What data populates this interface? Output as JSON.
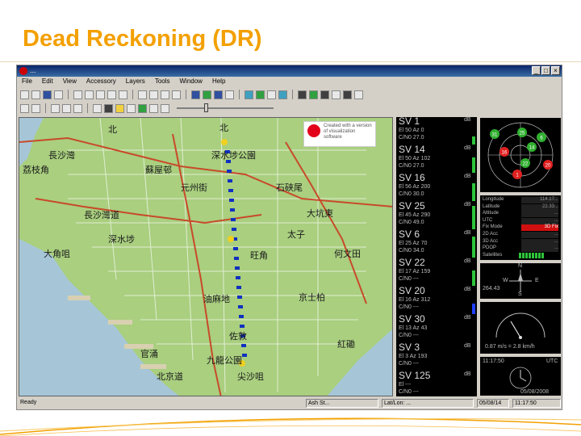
{
  "slide": {
    "title": "Dead Reckoning (DR)"
  },
  "window": {
    "title": "...",
    "menu": [
      "File",
      "Edit",
      "View",
      "Accessory",
      "Layers",
      "Tools",
      "Window",
      "Help"
    ]
  },
  "map": {
    "watermark": "Created with a version of\nvisualization software",
    "labels": [
      {
        "text": "北",
        "l": 110,
        "t": 6
      },
      {
        "text": "北",
        "l": 248,
        "t": 4
      },
      {
        "text": "深水埗公園",
        "l": 238,
        "t": 38
      },
      {
        "text": "長沙灣",
        "l": 36,
        "t": 38
      },
      {
        "text": "蘇屋邨",
        "l": 156,
        "t": 56
      },
      {
        "text": "荔枝角",
        "l": 4,
        "t": 56
      },
      {
        "text": "元州街",
        "l": 200,
        "t": 78
      },
      {
        "text": "石硤尾",
        "l": 318,
        "t": 78
      },
      {
        "text": "大坑東",
        "l": 356,
        "t": 110
      },
      {
        "text": "長沙灣道",
        "l": 80,
        "t": 112
      },
      {
        "text": "深水埗",
        "l": 110,
        "t": 142
      },
      {
        "text": "太子",
        "l": 332,
        "t": 136
      },
      {
        "text": "大角咀",
        "l": 30,
        "t": 160
      },
      {
        "text": "旺角",
        "l": 286,
        "t": 162
      },
      {
        "text": "何文田",
        "l": 390,
        "t": 160
      },
      {
        "text": "油麻地",
        "l": 228,
        "t": 216
      },
      {
        "text": "京士柏",
        "l": 346,
        "t": 214
      },
      {
        "text": "佐敦",
        "l": 260,
        "t": 262
      },
      {
        "text": "官涌",
        "l": 150,
        "t": 284
      },
      {
        "text": "紅磡",
        "l": 394,
        "t": 272
      },
      {
        "text": "尖沙咀",
        "l": 270,
        "t": 312
      },
      {
        "text": "北京道",
        "l": 170,
        "t": 312
      },
      {
        "text": "九龍公園",
        "l": 232,
        "t": 292
      }
    ]
  },
  "satellites": [
    {
      "name": "SV 1",
      "el": "El 50 Az 0",
      "cn": "C/N0 27.0",
      "bar": 30,
      "blue": false
    },
    {
      "name": "SV 14",
      "el": "El 50 Az 102",
      "cn": "C/N0 27.0",
      "bar": 60,
      "blue": false
    },
    {
      "name": "SV 16",
      "el": "El 56 Az 200",
      "cn": "C/N0 30.0",
      "bar": 70,
      "blue": false
    },
    {
      "name": "SV 25",
      "el": "El 45 Az 290",
      "cn": "C/N0 49.0",
      "bar": 90,
      "blue": false
    },
    {
      "name": "SV 6",
      "el": "El 25 Az 70",
      "cn": "C/N0 34.0",
      "bar": 80,
      "blue": false
    },
    {
      "name": "SV 22",
      "el": "El 17 Az 159",
      "cn": "C/N0 ---",
      "bar": 60,
      "blue": false
    },
    {
      "name": "SV 20",
      "el": "El 16 Az 312",
      "cn": "C/N0 ---",
      "bar": 40,
      "blue": true
    },
    {
      "name": "SV 30",
      "el": "El 13 Az 43",
      "cn": "C/N0 ---",
      "bar": 0,
      "blue": false
    },
    {
      "name": "SV 3",
      "el": "El 3 Az 193",
      "cn": "C/N0 ---",
      "bar": 0,
      "blue": false
    },
    {
      "name": "SV 125",
      "el": "El ---",
      "cn": "C/N0 ---",
      "bar": 0,
      "blue": false
    }
  ],
  "sv_unit": "dB",
  "sky": {
    "dots": [
      {
        "id": "31",
        "color": "#30b030"
      },
      {
        "id": "25",
        "color": "#30b030"
      },
      {
        "id": "6",
        "color": "#30b030"
      },
      {
        "id": "14",
        "color": "#30b030"
      },
      {
        "id": "16",
        "color": "#e02020"
      },
      {
        "id": "22",
        "color": "#30b030"
      },
      {
        "id": "1",
        "color": "#e02020"
      },
      {
        "id": "20",
        "color": "#e02020"
      }
    ]
  },
  "info": {
    "rows": [
      {
        "k": "Longitude",
        "v": "114.17...",
        "red": false
      },
      {
        "k": "Latitude",
        "v": "22.33...",
        "red": false
      },
      {
        "k": "Altitude",
        "v": "...",
        "red": false
      },
      {
        "k": "UTC",
        "v": "...",
        "red": false
      },
      {
        "k": "Fix Mode",
        "v": "3D Fix",
        "red": true
      },
      {
        "k": "2D Acc",
        "v": "...",
        "red": false
      },
      {
        "k": "3D Acc",
        "v": "...",
        "red": false
      },
      {
        "k": "PDOP",
        "v": "...",
        "red": false
      }
    ],
    "satellites_label": "Satellites"
  },
  "compass": {
    "n": "N",
    "w": "W",
    "e": "E",
    "s": "S",
    "heading": "264.43"
  },
  "speedo": {
    "value": "0.87 m/s = 2.8 km/h"
  },
  "clock": {
    "time": "11:17:50",
    "zone": "UTC",
    "date": "05/08/2008"
  },
  "statusbar": {
    "ready": "Ready",
    "f2": "Ash St...",
    "f3": "Lat/Lon: ...",
    "f4": "05/08/14",
    "f5": "11:17:50"
  },
  "colors": {
    "title": "#f3a000",
    "map_bg": "#a9cf7f",
    "road": "#c84a2a",
    "track": "#1030c0",
    "water": "#a6c6d8"
  }
}
